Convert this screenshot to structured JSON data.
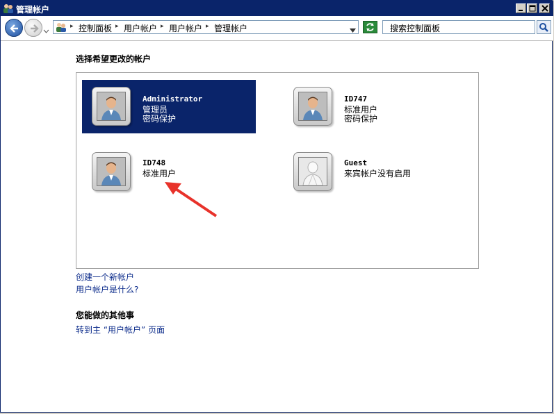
{
  "window": {
    "title": "管理帐户"
  },
  "address_bar": {
    "crumbs": [
      "控制面板",
      "用户帐户",
      "用户帐户",
      "管理帐户"
    ]
  },
  "search": {
    "placeholder": "搜索控制面板"
  },
  "main": {
    "heading": "选择希望更改的帐户",
    "accounts": [
      {
        "name": "Administrator",
        "line1": "管理员",
        "line2": "密码保护",
        "selected": true
      },
      {
        "name": "ID747",
        "line1": "标准用户",
        "line2": "密码保护",
        "selected": false
      },
      {
        "name": "ID748",
        "line1": "标准用户",
        "line2": "",
        "selected": false
      },
      {
        "name": "Guest",
        "line1": "来宾帐户没有启用",
        "line2": "",
        "selected": false
      }
    ],
    "links": [
      "创建一个新帐户",
      "用户帐户是什么?"
    ],
    "other_heading": "您能做的其他事",
    "other_links": [
      "转到主 “用户帐户” 页面"
    ]
  },
  "colors": {
    "selection": "#0a246a",
    "link": "#0a2a8a",
    "annotation_arrow": "#e8322a"
  },
  "icons": [
    "user-accounts-icon",
    "back-arrow-icon",
    "forward-arrow-icon",
    "refresh-icon",
    "search-icon",
    "user-avatar-icon",
    "guest-avatar-icon"
  ]
}
